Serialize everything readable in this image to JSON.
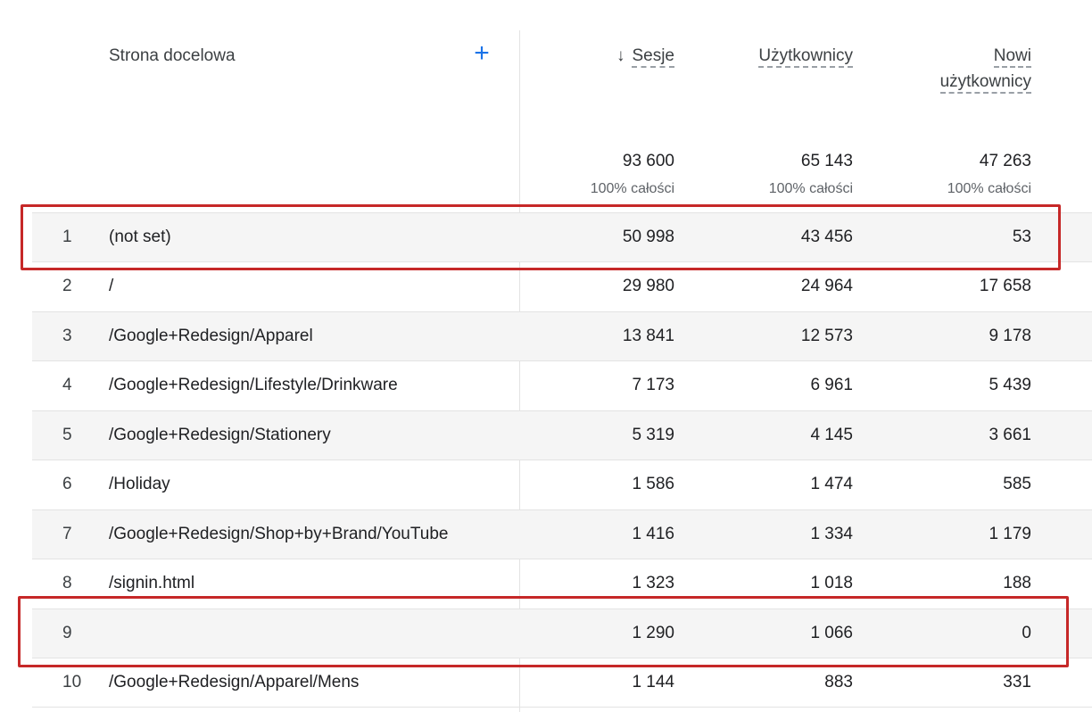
{
  "table": {
    "dimension_header": "Strona docelowa",
    "add_dimension_icon": "plus-icon",
    "sort_icon": "arrow-down-icon",
    "columns": [
      {
        "label": "Sesje",
        "total": "93 600",
        "total_pct": "100% całości",
        "sorted": true
      },
      {
        "label": "Użytkownicy",
        "total": "65 143",
        "total_pct": "100% całości"
      },
      {
        "label_line1": "Nowi",
        "label_line2": "użytkownicy",
        "total": "47 263",
        "total_pct": "100% całości"
      }
    ],
    "rows": [
      {
        "index": "1",
        "page": "(not set)",
        "sessions": "50 998",
        "users": "43 456",
        "new_users": "53",
        "highlighted": true
      },
      {
        "index": "2",
        "page": "/",
        "sessions": "29 980",
        "users": "24 964",
        "new_users": "17 658"
      },
      {
        "index": "3",
        "page": "/Google+Redesign/Apparel",
        "sessions": "13 841",
        "users": "12 573",
        "new_users": "9 178"
      },
      {
        "index": "4",
        "page": "/Google+Redesign/Lifestyle/Drinkware",
        "sessions": "7 173",
        "users": "6 961",
        "new_users": "5 439"
      },
      {
        "index": "5",
        "page": "/Google+Redesign/Stationery",
        "sessions": "5 319",
        "users": "4 145",
        "new_users": "3 661"
      },
      {
        "index": "6",
        "page": "/Holiday",
        "sessions": "1 586",
        "users": "1 474",
        "new_users": "585"
      },
      {
        "index": "7",
        "page": "/Google+Redesign/Shop+by+Brand/YouTube",
        "sessions": "1 416",
        "users": "1 334",
        "new_users": "1 179"
      },
      {
        "index": "8",
        "page": "/signin.html",
        "sessions": "1 323",
        "users": "1 018",
        "new_users": "188"
      },
      {
        "index": "9",
        "page": "",
        "sessions": "1 290",
        "users": "1 066",
        "new_users": "0",
        "highlighted": true
      },
      {
        "index": "10",
        "page": "/Google+Redesign/Apparel/Mens",
        "sessions": "1 144",
        "users": "883",
        "new_users": "331"
      }
    ]
  },
  "colors": {
    "accent": "#1a73e8",
    "highlight_border": "#c62828",
    "row_shade": "#f5f5f5"
  }
}
